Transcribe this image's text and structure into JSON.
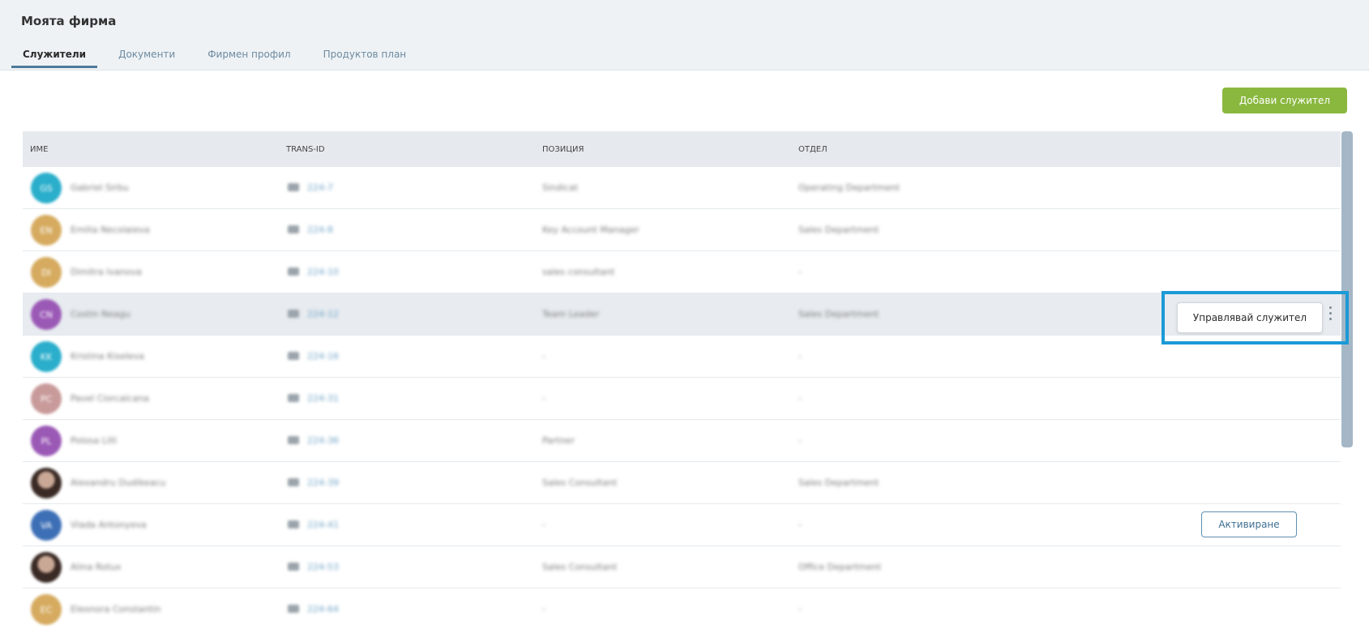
{
  "page": {
    "title": "Моята фирма"
  },
  "tabs": [
    {
      "label": "Служители",
      "active": true
    },
    {
      "label": "Документи",
      "active": false
    },
    {
      "label": "Фирмен профил",
      "active": false
    },
    {
      "label": "Продуктов план",
      "active": false
    }
  ],
  "toolbar": {
    "add_label": "Добави служител"
  },
  "table": {
    "headers": {
      "name": "ИМЕ",
      "trans_id": "TRANS-ID",
      "position": "ПОЗИЦИЯ",
      "department": "ОТДЕЛ"
    },
    "rows": [
      {
        "initials": "GS",
        "avatar_color": "#2aaecb",
        "name": "Gabriel Sirbu",
        "trans_id": "224-7",
        "position": "Sindicat",
        "department": "Operating Department"
      },
      {
        "initials": "EN",
        "avatar_color": "#d6ab60",
        "name": "Emilia Necolaieva",
        "trans_id": "224-8",
        "position": "Key Account Manager",
        "department": "Sales Department"
      },
      {
        "initials": "DI",
        "avatar_color": "#d6ab60",
        "name": "Dimitra Ivanova",
        "trans_id": "224-10",
        "position": "sales consultant",
        "department": "-"
      },
      {
        "initials": "CN",
        "avatar_color": "#9b59b6",
        "name": "Costin Neagu",
        "trans_id": "224-12",
        "position": "Team Leader",
        "department": "Sales Department",
        "highlighted": true
      },
      {
        "initials": "KK",
        "avatar_color": "#2aaecb",
        "name": "Kristina Kiseleva",
        "trans_id": "224-16",
        "position": "-",
        "department": "-"
      },
      {
        "initials": "PC",
        "avatar_color": "#c99a9a",
        "name": "Pavel Ciorcalcana",
        "trans_id": "224-31",
        "position": "-",
        "department": "-"
      },
      {
        "initials": "PL",
        "avatar_color": "#9b59b6",
        "name": "Polosa Lilli",
        "trans_id": "224-36",
        "position": "Partner",
        "department": "-"
      },
      {
        "initials": "",
        "avatar_color": "#3a2a25",
        "photo": true,
        "name": "Alexandru Dudikeacu",
        "trans_id": "224-39",
        "position": "Sales Consultant",
        "department": "Sales Department"
      },
      {
        "initials": "VA",
        "avatar_color": "#3d6fb6",
        "name": "Vlada Antonyeva",
        "trans_id": "224-41",
        "position": "-",
        "department": "-",
        "action": "Активиране"
      },
      {
        "initials": "",
        "avatar_color": "#3a2a25",
        "photo": true,
        "name": "Alina Rotux",
        "trans_id": "224-53",
        "position": "Sales Consultant",
        "department": "Office Department"
      },
      {
        "initials": "EC",
        "avatar_color": "#d6ab60",
        "name": "Eleonora Constantin",
        "trans_id": "224-64",
        "position": "-",
        "department": "-"
      }
    ]
  },
  "row_menu": {
    "manage_label": "Управлявай служител"
  },
  "colors": {
    "accent_green": "#8ab83f",
    "highlight_border": "#1a9ad6",
    "link_blue": "#6aa0c4"
  }
}
